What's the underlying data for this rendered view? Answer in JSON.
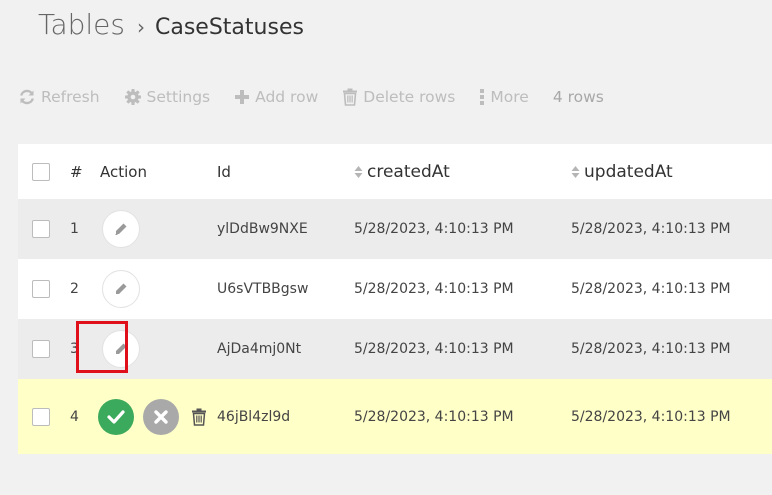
{
  "breadcrumb": {
    "root": "Tables",
    "separator": "›",
    "current": "CaseStatuses"
  },
  "toolbar": {
    "refresh": "Refresh",
    "settings": "Settings",
    "add_row": "Add row",
    "delete_rows": "Delete rows",
    "more": "More",
    "row_count": "4 rows"
  },
  "table": {
    "headers": {
      "num": "#",
      "action": "Action",
      "id": "Id",
      "created": "createdAt",
      "updated": "updatedAt"
    },
    "rows": [
      {
        "num": "1",
        "id": "ylDdBw9NXE",
        "created": "5/28/2023, 4:10:13 PM",
        "updated": "5/28/2023, 4:10:13 PM"
      },
      {
        "num": "2",
        "id": "U6sVTBBgsw",
        "created": "5/28/2023, 4:10:13 PM",
        "updated": "5/28/2023, 4:10:13 PM"
      },
      {
        "num": "3",
        "id": "AjDa4mj0Nt",
        "created": "5/28/2023, 4:10:13 PM",
        "updated": "5/28/2023, 4:10:13 PM"
      },
      {
        "num": "4",
        "id": "46jBl4zl9d",
        "created": "5/28/2023, 4:10:13 PM",
        "updated": "5/28/2023, 4:10:13 PM"
      }
    ]
  },
  "icons": {
    "refresh": "refresh-icon",
    "settings": "gear-icon",
    "add": "plus-icon",
    "delete": "trash-icon",
    "more": "more-vertical-icon",
    "edit": "pencil-icon",
    "save": "check-icon",
    "cancel": "close-icon",
    "sort": "sort-icon"
  },
  "colors": {
    "highlight": "#e0101a",
    "save": "#3caa5c",
    "cancel": "#a9a9a9",
    "edit_row": "#ffffc8",
    "alt_row": "#ececec"
  }
}
